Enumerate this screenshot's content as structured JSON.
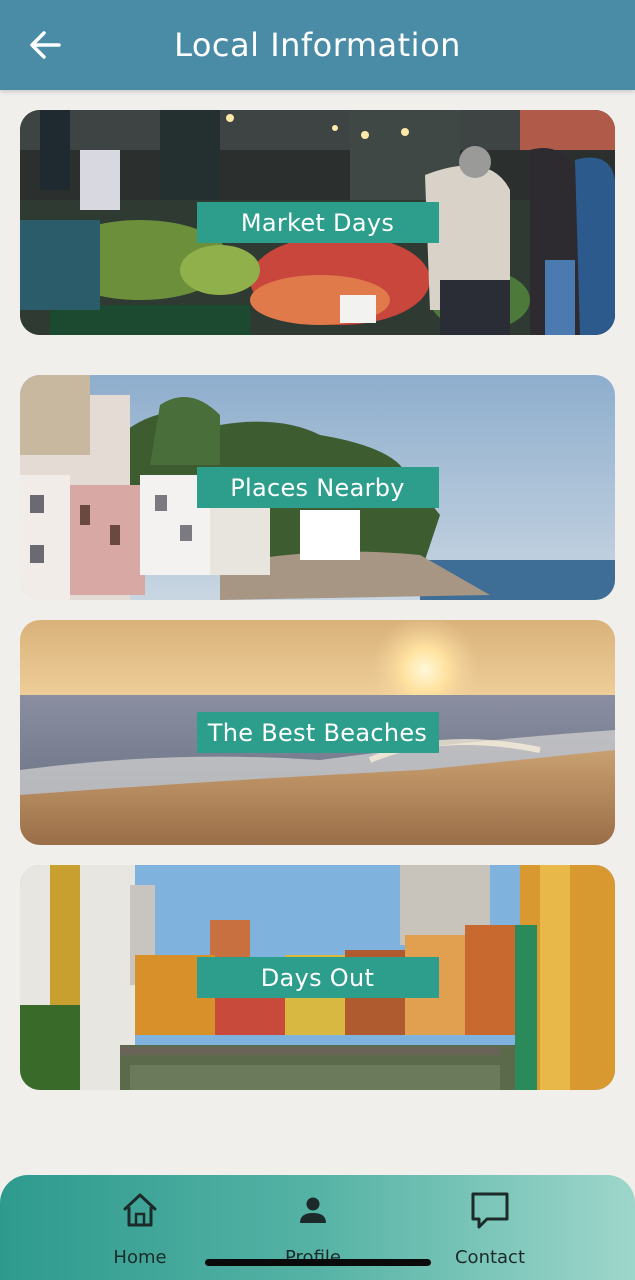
{
  "header": {
    "title": "Local Information",
    "back_icon": "arrow-left-icon"
  },
  "cards": [
    {
      "label": "Market Days",
      "image": "market-stalls-photo"
    },
    {
      "label": "Places Nearby",
      "image": "coastal-town-photo"
    },
    {
      "label": "The Best Beaches",
      "image": "beach-sunset-photo"
    },
    {
      "label": "Days Out",
      "image": "colorful-riverside-houses-photo"
    }
  ],
  "nav": {
    "items": [
      {
        "label": "Home",
        "icon": "home-icon"
      },
      {
        "label": "Profile",
        "icon": "person-icon"
      },
      {
        "label": "Contact",
        "icon": "chat-bubble-icon"
      }
    ]
  },
  "colors": {
    "header": "#4a8ba6",
    "label_bg": "#2d9e8c",
    "background": "#f0efec",
    "nav_gradient_start": "#2e9a8e",
    "nav_gradient_end": "#9ed6cb"
  }
}
